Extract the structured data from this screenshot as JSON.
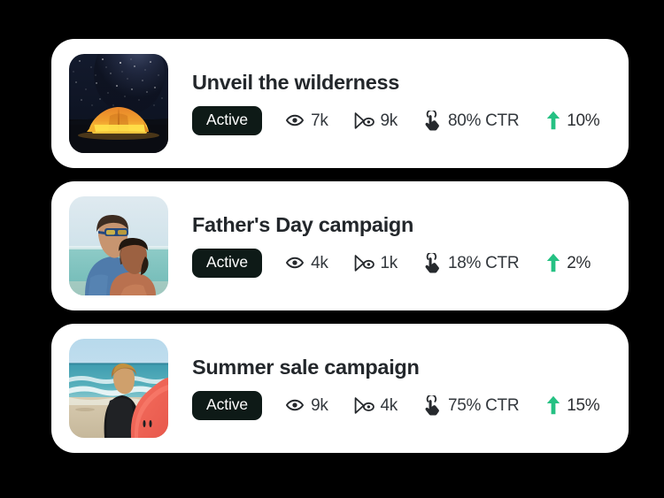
{
  "theme": {
    "background": "#000000",
    "card_background": "#ffffff",
    "badge_background": "#0e1a17",
    "badge_text": "#ffffff",
    "title_color": "#23272b",
    "stat_color": "#33383d",
    "trend_color": "#25c183"
  },
  "icons": {
    "impressions": "eye-icon",
    "views": "cursor-eye-icon",
    "clicks": "tap-hand-icon",
    "trend": "arrow-up-icon"
  },
  "cards": [
    {
      "title": "Unveil the wilderness",
      "status": "Active",
      "thumbnail_alt": "night-sky-tent-thumbnail",
      "impressions": "7k",
      "views": "9k",
      "ctr": "80% CTR",
      "trend": "10%"
    },
    {
      "title": "Father's Day campaign",
      "status": "Active",
      "thumbnail_alt": "father-and-son-beach-thumbnail",
      "impressions": "4k",
      "views": "1k",
      "ctr": "18% CTR",
      "trend": "2%"
    },
    {
      "title": "Summer sale campaign",
      "status": "Active",
      "thumbnail_alt": "surfer-beach-thumbnail",
      "impressions": "9k",
      "views": "4k",
      "ctr": "75% CTR",
      "trend": "15%"
    }
  ]
}
